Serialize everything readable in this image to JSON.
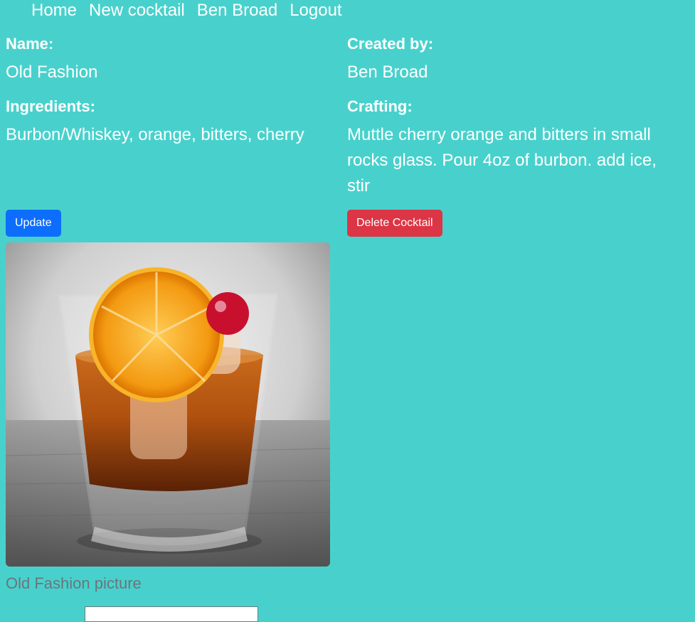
{
  "nav": {
    "items": [
      {
        "label": "Home"
      },
      {
        "label": "New cocktail"
      },
      {
        "label": "Ben Broad"
      },
      {
        "label": "Logout"
      }
    ]
  },
  "cocktail": {
    "name_label": "Name:",
    "name": "Old Fashion",
    "creator_label": "Created by:",
    "creator": "Ben Broad",
    "ingredients_label": "Ingredients:",
    "ingredients": "Burbon/Whiskey, orange, bitters, cherry",
    "crafting_label": "Crafting:",
    "crafting": "Muttle cherry orange and bitters in small rocks glass. Pour 4oz of burbon. add ice, stir"
  },
  "actions": {
    "update_label": "Update",
    "delete_label": "Delete Cocktail"
  },
  "image": {
    "caption": "Old Fashion picture"
  },
  "colors": {
    "background": "#48d1cc",
    "update_button": "#0d6efd",
    "delete_button": "#dc3545",
    "caption_text": "#6c757d"
  }
}
